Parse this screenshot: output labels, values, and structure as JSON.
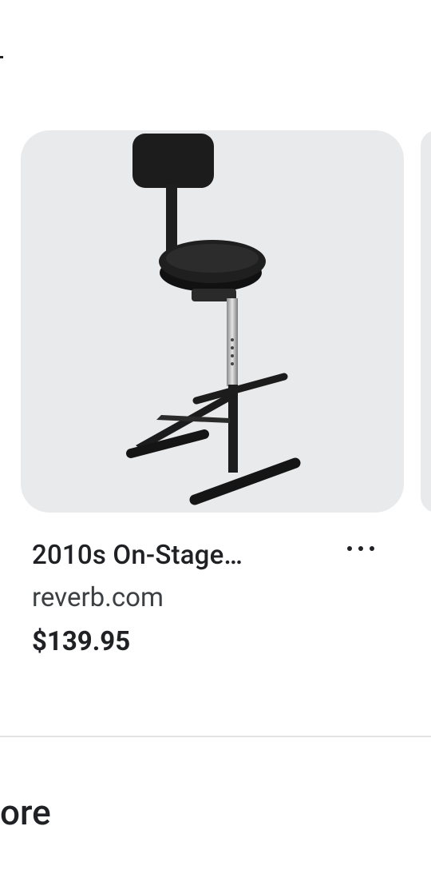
{
  "product": {
    "title": "2010s On-Stage…",
    "source": "reverb.com",
    "price": "$139.95",
    "image_icon": "guitar-stool-image",
    "more_icon": "more-horizontal-icon"
  },
  "section": {
    "heading": "ore"
  },
  "colors": {
    "card_background": "#e8eaeb",
    "text_primary": "#202124",
    "text_secondary": "#3c4043",
    "divider": "#e3e3e3"
  }
}
